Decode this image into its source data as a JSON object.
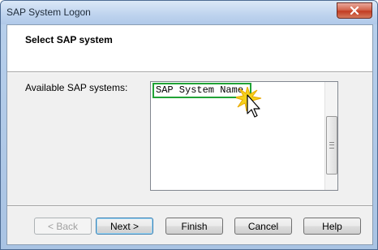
{
  "window": {
    "title": "SAP System Logon"
  },
  "header": {
    "title": "Select SAP system"
  },
  "systems": {
    "label": "Available SAP systems:",
    "items": [
      "SAP System Name"
    ],
    "selected_index": 0
  },
  "buttons": {
    "back": "< Back",
    "next": "Next >",
    "finish": "Finish",
    "cancel": "Cancel",
    "help": "Help"
  },
  "colors": {
    "selection_border": "#21a336",
    "title_bar": "#bed3ee",
    "close_button": "#c23c22",
    "cursor_highlight": "#f5d21b"
  },
  "icons": {
    "close": "close-icon",
    "cursor": "mouse-pointer-icon",
    "scroll_grip": "grip-icon"
  }
}
